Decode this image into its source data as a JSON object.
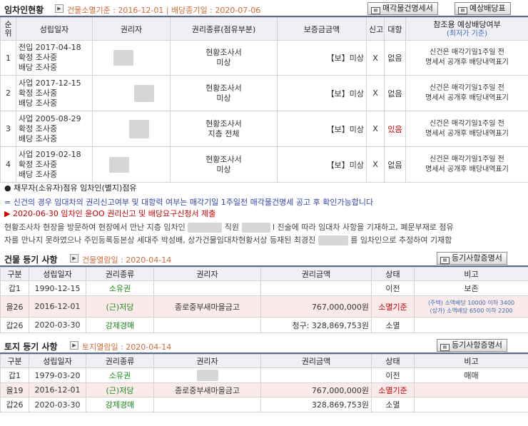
{
  "tenant": {
    "title": "임차인현황",
    "subtitle": "건물소멸기준 : 2016-12-01 | 배당종기일 : 2020-07-06",
    "btn_status": "매각물건명세서",
    "btn_dividend": "예상배당표",
    "headers": {
      "no": "순위",
      "date": "성립일자",
      "holder": "권리자",
      "right_type": "권리종류(점유부분)",
      "deposit": "보증금금액",
      "report": "신고",
      "contest": "대항",
      "ref_a": "참조용 예상배당여부",
      "ref_b": "(최저가 기준)"
    },
    "rows": [
      {
        "no": "1",
        "l1": "전입 2017-04-18",
        "l2": "확정 조사중",
        "l3": "배당 조사중",
        "t1": "현황조사서",
        "t2": "미상",
        "deposit": "【보】미상",
        "report": "X",
        "contest": "없음",
        "r1": "신건은 매각기일1주일 전",
        "r2": "명세서 공개후 배당내역표기"
      },
      {
        "no": "2",
        "l1": "사업 2017-12-15",
        "l2": "확정 조사중",
        "l3": "배당 조사중",
        "t1": "현황조사서",
        "t2": "미상",
        "deposit": "【보】미상",
        "report": "X",
        "contest": "없음",
        "r1": "신건은 매각기일1주일 전",
        "r2": "명세서 공개후 배당내역표기"
      },
      {
        "no": "3",
        "l1": "사업 2005-08-29",
        "l2": "확정 조사중",
        "l3": "배당 조사중",
        "t1": "현황조사서",
        "t2": "지층 전체",
        "deposit": "【보】미상",
        "report": "X",
        "contest": "있음",
        "r1": "신건은 매각기일1주일 전",
        "r2": "명세서 공개후 배당내역표기"
      },
      {
        "no": "4",
        "l1": "사업 2019-02-18",
        "l2": "확정 조사중",
        "l3": "배당 조사중",
        "t1": "현황조사서",
        "t2": "미상",
        "deposit": "【보】미상",
        "report": "X",
        "contest": "없음",
        "r1": "신건은 매각기일1주일 전",
        "r2": "명세서 공개후 배당내역표기"
      }
    ],
    "note_black": "● 채무자(소유자)점유 임차인(별지)점유",
    "note_blue": "= 신건의 경우 임대차의 권리신고여부 및 대항력 여부는 매각기일 1주일전 매각물건명세 공고 후 확인가능합니다",
    "note_red": "▶ 2020-06-30 임차인 윤OO 권리신고 및 배당요구신청서 제출",
    "para_a": "현황조사차 현장을 방문하여 현장에서 만난 지층 임차인",
    "para_b": "직원",
    "para_c": "l 진술에 따라 임대차 사항을 기재하고, 폐문부재로 점유",
    "para_d": "자를 만나지 못하였으나 주민등록등본상 세대주 박성배, 상가건물임대차현황서상 등재된 최경진",
    "para_e": "를 임차인으로 추정하여 기재함"
  },
  "building": {
    "title": "건물 등기 사항",
    "subtitle": "건물열람일 : 2020-04-14",
    "btn": "등기사항증명서",
    "headers": [
      "구분",
      "성립일자",
      "권리종류",
      "권리자",
      "권리금액",
      "상태",
      "비고"
    ],
    "rows": [
      {
        "g": "갑1",
        "date": "1990-12-15",
        "type": "소유권",
        "holder": "",
        "amount": "",
        "status": "이전",
        "remark": "보존"
      },
      {
        "g": "을26",
        "date": "2016-12-01",
        "type": "(근)저당",
        "holder": "종로중부새마을금고",
        "amount": "767,000,000원",
        "status": "소멸기준",
        "remark_1": "(주택) 소액배당 10000 이하 3400",
        "remark_2": "(상가) 소액배당 6500 이하 2200"
      },
      {
        "g": "갑26",
        "date": "2020-03-30",
        "type": "강제경매",
        "holder": "",
        "amount": "청구: 328,869,753원",
        "status": "소멸",
        "remark": ""
      }
    ]
  },
  "land": {
    "title": "토지 등기 사항",
    "subtitle": "토지열람일 : 2020-04-14",
    "btn": "등기사항증명서",
    "headers": [
      "구분",
      "성립일자",
      "권리종류",
      "권리자",
      "권리금액",
      "상태",
      "비고"
    ],
    "rows": [
      {
        "g": "갑1",
        "date": "1979-03-20",
        "type": "소유권",
        "holder": "",
        "amount": "",
        "status": "이전",
        "remark": "매매"
      },
      {
        "g": "을19",
        "date": "2016-12-01",
        "type": "(근)저당",
        "holder": "종로중부새마을금고",
        "amount": "767,000,000원",
        "status": "소멸기준",
        "remark": ""
      },
      {
        "g": "갑26",
        "date": "2020-03-30",
        "type": "강제경매",
        "holder": "",
        "amount": "328,869,753원",
        "status": "소멸",
        "remark": ""
      }
    ]
  }
}
